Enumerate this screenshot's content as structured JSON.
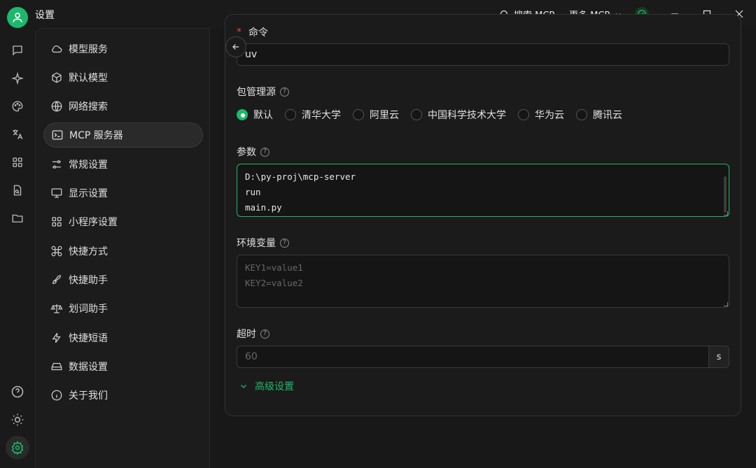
{
  "titlebar": {
    "title": "设置",
    "search_mcp": "搜索 MCP",
    "more_mcp": "更多 MCP"
  },
  "sidebar": {
    "items": [
      {
        "label": "模型服务",
        "icon": "cloud-icon"
      },
      {
        "label": "默认模型",
        "icon": "cube-icon"
      },
      {
        "label": "网络搜索",
        "icon": "globe-icon"
      },
      {
        "label": "MCP 服务器",
        "icon": "terminal-icon"
      },
      {
        "label": "常规设置",
        "icon": "sliders-icon"
      },
      {
        "label": "显示设置",
        "icon": "monitor-icon"
      },
      {
        "label": "小程序设置",
        "icon": "grid-icon"
      },
      {
        "label": "快捷方式",
        "icon": "command-icon"
      },
      {
        "label": "快捷助手",
        "icon": "rocket-icon"
      },
      {
        "label": "划词助手",
        "icon": "scale-icon"
      },
      {
        "label": "快捷短语",
        "icon": "zap-icon"
      },
      {
        "label": "数据设置",
        "icon": "hard-drive-icon"
      },
      {
        "label": "关于我们",
        "icon": "info-icon"
      }
    ],
    "active_index": 3
  },
  "form": {
    "command": {
      "label": "命令",
      "value": "uv"
    },
    "package_source": {
      "label": "包管理源",
      "options": [
        "默认",
        "清华大学",
        "阿里云",
        "中国科学技术大学",
        "华为云",
        "腾讯云"
      ],
      "selected": "默认"
    },
    "args": {
      "label": "参数",
      "lines": [
        "D:\\py-proj\\mcp-server",
        "run",
        "main.py"
      ]
    },
    "env": {
      "label": "环境变量",
      "placeholder_lines": [
        "KEY1=value1",
        "KEY2=value2"
      ]
    },
    "timeout": {
      "label": "超时",
      "placeholder": "60",
      "unit": "s"
    },
    "advanced_label": "高级设置"
  },
  "colors": {
    "accent": "#1db96a",
    "background": "#181818",
    "required": "#e5484d"
  }
}
